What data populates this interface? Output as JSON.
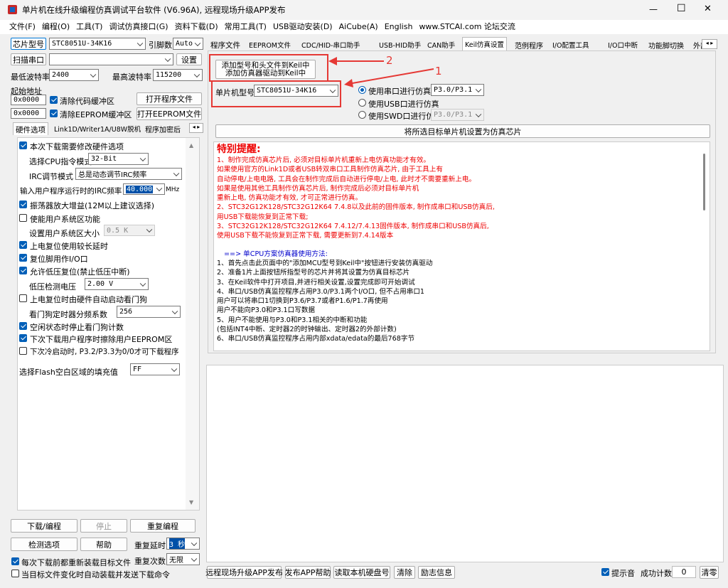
{
  "window": {
    "title": "单片机在线升级编程仿真调试平台软件 (V6.96A), 远程现场升级APP发布",
    "min": "—",
    "max": "☐",
    "close": "✕"
  },
  "menu": [
    "文件(F)",
    "编程(O)",
    "工具(T)",
    "调试仿真接口(G)",
    "资料下载(D)",
    "常用工具(T)",
    "USB驱动安装(D)",
    "AiCube(A)",
    "English",
    "www.STCAI.com 论坛交流"
  ],
  "left": {
    "chip_btn": "芯片型号",
    "chip_value": "STC8051U-34K16",
    "pin_label": "引脚数",
    "pin_value": "Auto",
    "scan_btn": "扫描串口",
    "port_value": "",
    "settings_btn": "设置",
    "min_baud_label": "最低波特率",
    "min_baud": "2400",
    "max_baud_label": "最高波特率",
    "max_baud": "115200",
    "start_addr_label": "起始地址",
    "addr1": "0x0000",
    "clear_code": "清除代码缓冲区",
    "open_prog": "打开程序文件",
    "addr2": "0x0000",
    "clear_eeprom": "清除EEPROM缓冲区",
    "open_eeprom": "打开EEPROM文件",
    "subtabs": [
      "硬件选项",
      "Link1D/Writer1A/U8W脱机",
      "程序加密后"
    ],
    "options": {
      "modify_hw": "本次下载需要修改硬件选项",
      "cpu_mode_label": "选择CPU指令模式",
      "cpu_mode": "32-Bit",
      "irc_mode_label": "IRC调节模式",
      "irc_mode": "总是动态调节IRC频率",
      "irc_freq_label": "输入用户程序运行时的IRC频率",
      "irc_freq": "40.000",
      "irc_unit": "MHz",
      "osc_gain": "振荡器放大增益(12M以上建议选择)",
      "sys_reset": "使能用户系统区功能",
      "sys_size_label": "设置用户系统区大小",
      "sys_size": "0.5 K",
      "long_delay": "上电复位使用较长延时",
      "reset_io": "复位脚用作I/O口",
      "lvr": "允许低压复位(禁止低压中断)",
      "lvd_label": "低压检测电压",
      "lvd": "2.00 V",
      "wdt_auto": "上电复位时由硬件自动启动看门狗",
      "wdt_div_label": "看门狗定时器分频系数",
      "wdt_div": "256",
      "idle_wdt": "空闲状态时停止看门狗计数",
      "erase_eeprom": "下次下载用户程序时擦除用户EEPROM区",
      "cold_start": "下次冷启动时, P3.2/P3.3为0/0才可下载程序",
      "flash_fill_label": "选择Flash空白区域的填充值",
      "flash_fill": "FF"
    },
    "download": "下载/编程",
    "stop": "停止",
    "repeat_prog": "重复编程",
    "detect": "检测选项",
    "help": "帮助",
    "repeat_delay_label": "重复延时",
    "repeat_delay": "3 秒",
    "repeat_count_label": "重复次数",
    "repeat_count": "无限",
    "reload_each": "每次下载前都重新装载目标文件",
    "auto_on_change": "当目标文件变化时自动装载并发送下载命令"
  },
  "tabs": [
    "程序文件",
    "EEPROM文件",
    "CDC/HID-串口助手",
    "USB-HID助手",
    "CAN助手",
    "Keil仿真设置",
    "范例程序",
    "I/O配置工具",
    "I/O口中断",
    "功能脚切换",
    "外部中断"
  ],
  "keil": {
    "add_btn_line1": "添加型号和头文件到Keil中",
    "add_btn_line2": "添加仿真器驱动到Keil中",
    "anno2": "2",
    "anno1": "1",
    "mcu_label": "单片机型号",
    "mcu_value": "STC8051U-34K16",
    "uart_sim": "使用串口进行仿真",
    "uart_port": "P3.0/P3.1",
    "usb_sim": "使用USB口进行仿真",
    "swd_sim": "使用SWD口进行仿真",
    "swd_port": "P3.0/P3.1",
    "set_chip_btn": "将所选目标单片机设置为仿真芯片"
  },
  "notice": {
    "title": "特别提醒:",
    "red_lines": [
      "1、制作完成仿真芯片后, 必须对目标单片机重新上电仿真功能才有效。",
      "    如果使用官方的Link1D或者USB转双串口工具制作仿真芯片, 由于工具上有",
      "    自动停电/上电电路, 工具会在制作完成后自动进行停电/上电, 此时才不需要重新上电。",
      "    如果是使用其他工具制作仿真芯片后, 制作完成后必须对目标单片机",
      "    重新上电, 仿真功能才有效, 才可正常进行仿真。",
      "2、STC32G12K128/STC32G12K64   7.4.8以及此前的固件版本, 制作成串口和USB仿真后,",
      "    用USB下载能恢复到正常下载;",
      "3、STC32G12K128/STC32G12K64   7.4.12/7.4.13固件版本, 制作成串口和USB仿真后,",
      "    使用USB下载不能恢复到正常下载, 需要更新到7.4.14版本"
    ],
    "blue_title": "==> 单CPU方案仿真器使用方法:",
    "black_lines": [
      "1、首先点击此页面中的\"添加MCU型号到Keil中\"按钮进行安装仿真驱动",
      "2、准备1片上面按钮所指型号的芯片并将其设置为仿真目标芯片",
      "3、在Keil软件中打开项目,并进行相关设置,设置完成即可开始调试",
      "4、串口/USB仿真监控程序占用P3.0/P3.1两个I/O口, 但不占用串口1",
      "    用户可以将串口1切换到P3.6/P3.7或者P1.6/P1.7再使用",
      "    用户不能向P3.0和P3.1口写数据",
      "5、用户不能使用与P3.0和P3.1相关的中断和功能",
      "    (包括INT4中断、定时器2的时钟输出、定时器2的外部计数)",
      "6、串口/USB仿真监控程序占用内部xdata/edata的最后768字节"
    ]
  },
  "bottom": {
    "remote_app": "远程现场升级APP发布",
    "publish_help": "发布APP帮助",
    "read_hdd": "读取本机硬盘号",
    "clear": "清除",
    "feedback": "励志信息",
    "sound": "提示音",
    "success_label": "成功计数",
    "success_count": "0",
    "clear_count": "清零"
  },
  "colors": {
    "accent": "#005fb8",
    "annotation": "#e53935",
    "notice_red": "#e00000"
  }
}
